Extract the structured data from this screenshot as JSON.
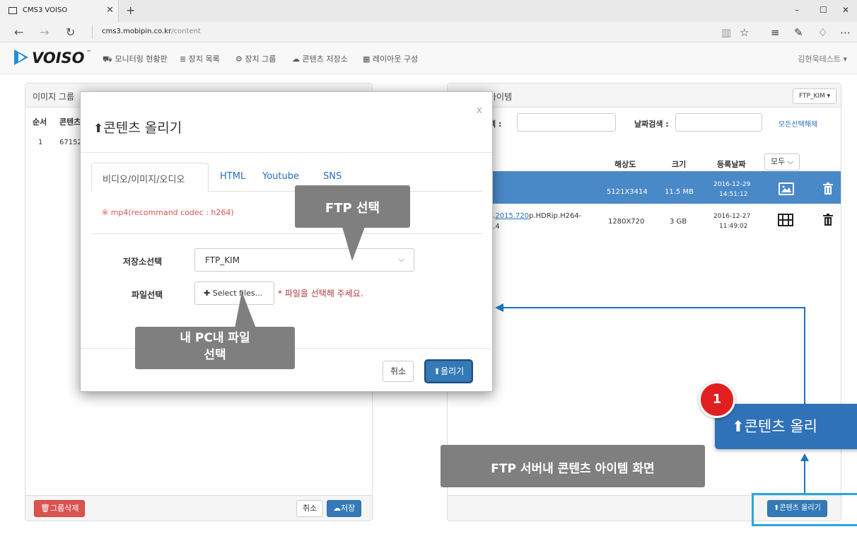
{
  "browser": {
    "tab_title": "CMS3 VOISO",
    "url_domain": "cms3.mobipin.co.kr",
    "url_path": "/content"
  },
  "navbar": {
    "logo_text": "VOISO",
    "menu": [
      "모니터링 현황판",
      "장치 목록",
      "장치 그룹",
      "콘텐츠 저장소",
      "레이아웃 구성"
    ],
    "user": "김현욱테스트"
  },
  "left_panel": {
    "title": "이미지 그룹",
    "col_order": "순서",
    "col_content": "콘텐츠",
    "row_order": "1",
    "row_id": "67152",
    "delete_group": "그룹삭제",
    "cancel": "취소",
    "save": "저장"
  },
  "right_panel": {
    "title": "아이템",
    "ftp_dropdown": "FTP_KIM",
    "search_label": "색 :",
    "date_search_label": "날짜검색 :",
    "deselect_all": "모든선택해제",
    "col_resolution": "해상도",
    "col_size": "크기",
    "col_date": "등록날짜",
    "filter_all": "모두",
    "rows": [
      {
        "name_link": "",
        "name_rest": "",
        "resolution": "5121X3414",
        "size": "11.5 MB",
        "date": "2016-12-29",
        "time": "14:51:12",
        "type": "image"
      },
      {
        "name_pre": "..",
        "name_link": "2015.720",
        "name_rest": "p.HDRip.H264-",
        "name_line2": "..4",
        "resolution": "1280X720",
        "size": "3 GB",
        "date": "2016-12-27",
        "time": "11:49:02",
        "type": "video"
      }
    ],
    "upload_button": "콘텐츠 올리기"
  },
  "modal": {
    "title": "콘텐츠 올리기",
    "close": "x",
    "tabs": [
      "비디오/이미지/오디오",
      "HTML",
      "Youtube",
      "SNS"
    ],
    "warning": "※ mp4(recommand codec : h264)",
    "storage_label": "저장소선택",
    "storage_value": "FTP_KIM",
    "file_label": "파일선택",
    "select_files": "Select files...",
    "file_message": "* 파일을 선택해 주세요.",
    "cancel": "취소",
    "upload": "올리기"
  },
  "annotations": {
    "ftp_select": "FTP 선택",
    "pc_file_line1": "내 PC내 파일",
    "pc_file_line2": "선택",
    "ftp_screen": "FTP 서버내 콘텐츠 아이템 화면",
    "step_number": "1",
    "big_upload": "콘텐츠 올리"
  },
  "colors": {
    "accent_blue": "#337ab7",
    "selected_row": "#4a89c8",
    "danger_red": "#d9534f",
    "callout_gray": "#7f7f7f",
    "badge_red": "#e02020",
    "highlight_cyan": "#29a6e0"
  }
}
